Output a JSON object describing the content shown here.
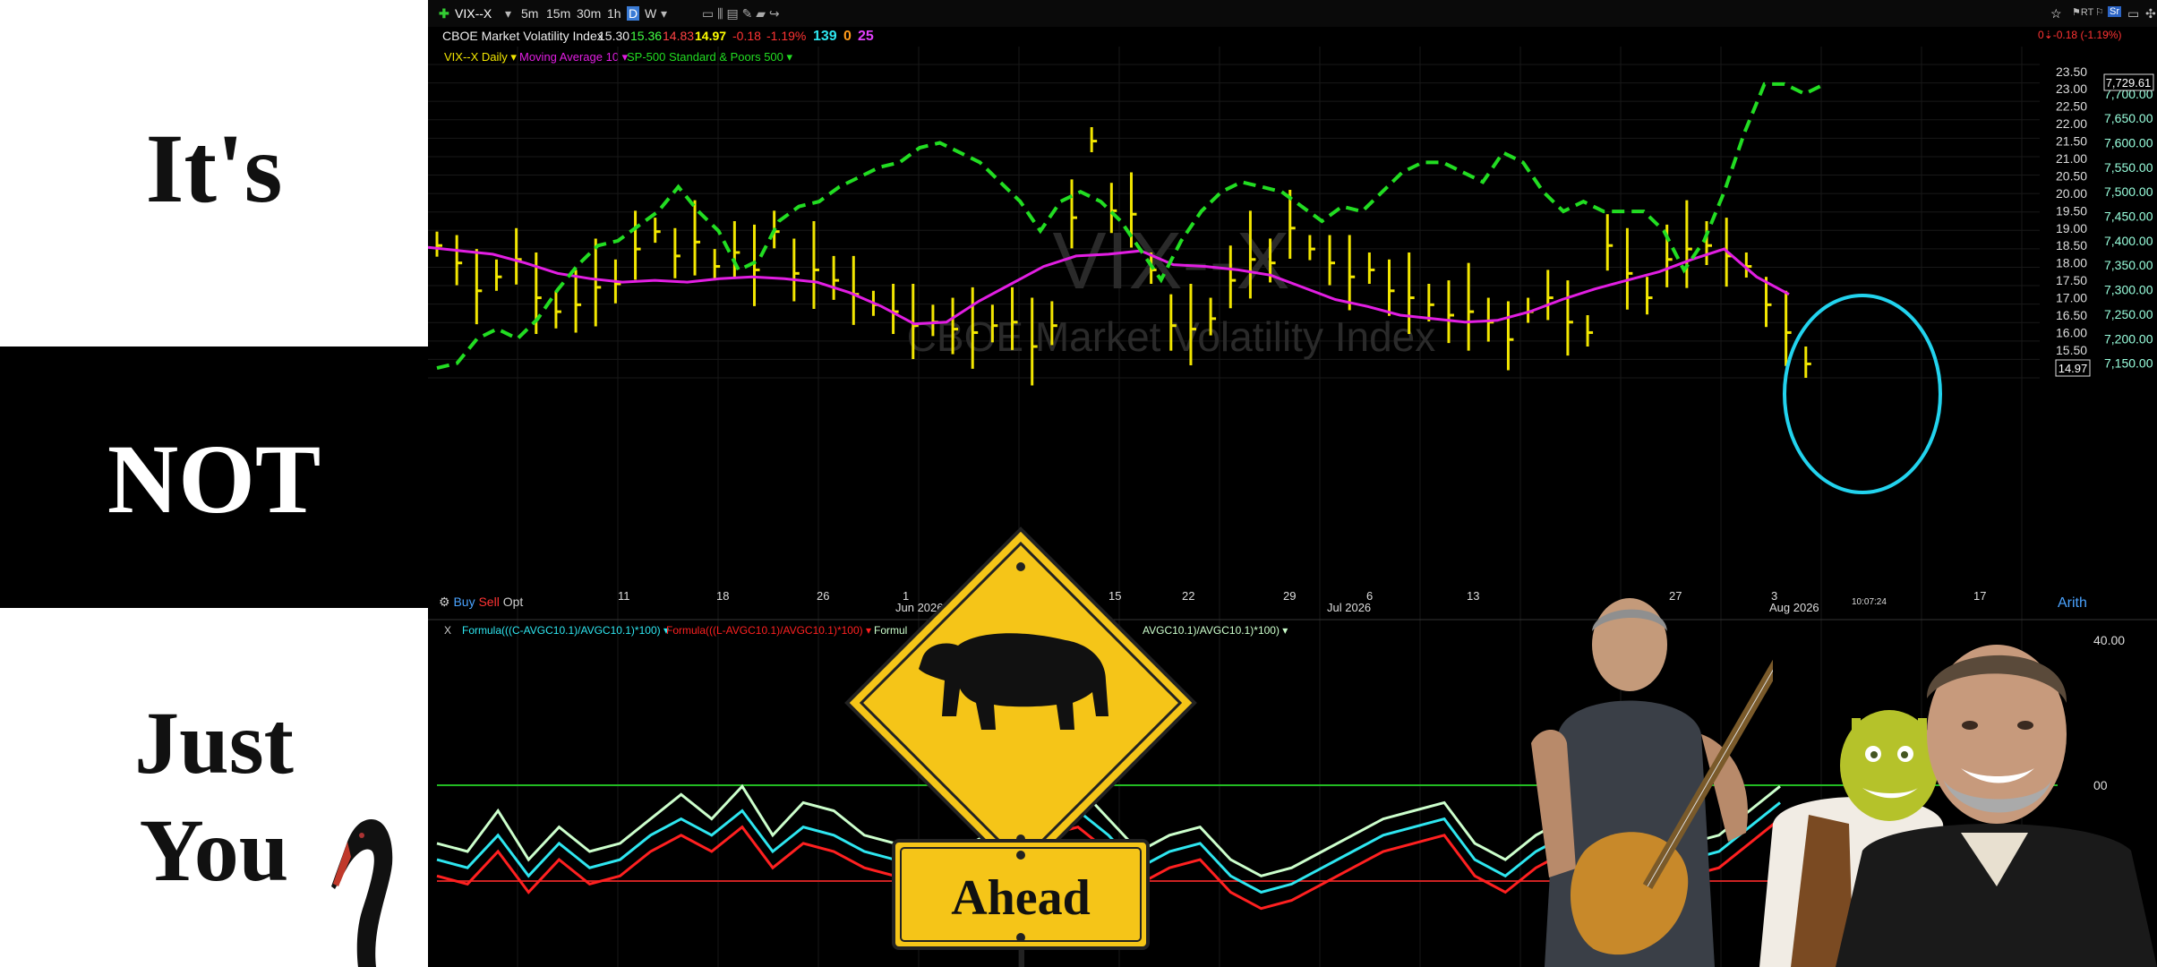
{
  "captions": {
    "line1": "It's",
    "line2": "NOT",
    "line3": "Just",
    "line4": "You"
  },
  "toolbar": {
    "symbol": "VIX--X",
    "intervals": [
      "5m",
      "15m",
      "30m",
      "1h",
      "D",
      "W"
    ],
    "active_interval": "D"
  },
  "quote": {
    "name": "CBOE Market Volatility Index",
    "open": "15.30",
    "high": "15.36",
    "low": "14.83",
    "close": "14.97",
    "change": "-0.18",
    "change_pct": "-1.19%",
    "stat_a": "139",
    "stat_b": "0",
    "stat_c": "25",
    "right_change": "0",
    "right_change_abs": "-0.18",
    "right_change_pct": "(-1.19%)"
  },
  "studies": {
    "price": "VIX--X Daily",
    "ma": "Moving Average 10",
    "overlay": "SP-500 Standard & Poors 500"
  },
  "watermark": {
    "symbol": "VIX--X",
    "name": "CBOE Market Volatility Index"
  },
  "last_price_label": "14.97",
  "last_sp_label": "7,729.61",
  "time_label": "10:07:24",
  "buy_sell": {
    "buy": "Buy",
    "sell": "Sell",
    "opt": "Opt"
  },
  "scale_mode": "Arith",
  "lower_panel": {
    "close_x": "X",
    "formula1": "Formula(((C-AVGC10.1)/AVGC10.1)*100)",
    "formula2": "Formula(((L-AVGC10.1)/AVGC10.1)*100)",
    "formula3": "Formul",
    "formula4": "AVGC10.1)/AVGC10.1)*100)",
    "tick_40": "40.00",
    "tick_20": "00"
  },
  "sign": {
    "text": "Ahead"
  },
  "colors": {
    "price_bars": "#f2e600",
    "moving_average": "#e21ee2",
    "sp500": "#22dd22",
    "circle": "#22d3ee",
    "formula_close": "#2ee6f0",
    "formula_low": "#ff2020",
    "formula_high": "#ccffcc",
    "sign_yellow": "#f5c518"
  },
  "chart_data": [
    {
      "type": "line",
      "title": "CBOE Market Volatility Index",
      "x_ticks": [
        "11",
        "18",
        "26",
        "1",
        "Jun 2026",
        "15",
        "22",
        "29",
        "Jul 2026",
        "6",
        "13",
        "27",
        "3",
        "Aug 2026",
        "17"
      ],
      "y_left_ticks": [
        "23.50",
        "23.00",
        "22.50",
        "22.00",
        "21.50",
        "21.00",
        "20.50",
        "20.00",
        "19.50",
        "19.00",
        "18.50",
        "18.00",
        "17.50",
        "17.00",
        "16.50",
        "16.00",
        "15.50",
        "15.00"
      ],
      "y_right_ticks": [
        "7,700.00",
        "7,650.00",
        "7,600.00",
        "7,550.00",
        "7,500.00",
        "7,450.00",
        "7,400.00",
        "7,350.00",
        "7,300.00",
        "7,250.00",
        "7,200.00",
        "7,150.00"
      ],
      "ylim_left": [
        14.7,
        23.7
      ],
      "ylim_right": [
        7120,
        7760
      ],
      "bar_count": 70,
      "price_closes": [
        18.5,
        18.0,
        17.2,
        17.6,
        18.1,
        17.0,
        16.6,
        16.8,
        17.3,
        17.4,
        18.4,
        18.9,
        18.2,
        18.6,
        17.9,
        18.3,
        17.8,
        18.9,
        17.7,
        17.8,
        17.5,
        17.1,
        16.8,
        16.6,
        16.2,
        16.3,
        16.1,
        16.0,
        16.2,
        16.3,
        15.6,
        16.2,
        19.3,
        21.5,
        19.5,
        19.4,
        17.8,
        16.2,
        16.1,
        16.4,
        17.5,
        18.1,
        18.0,
        19.0,
        18.4,
        18.0,
        17.6,
        17.8,
        17.2,
        17.0,
        16.8,
        16.5,
        16.6,
        16.3,
        15.8,
        16.6,
        17.0,
        16.3,
        16.0,
        18.5,
        17.7,
        17.0,
        18.1,
        18.4,
        18.5,
        18.2,
        17.9,
        16.8,
        16.0,
        15.1
      ],
      "ma_values": [
        18.45,
        18.35,
        18.25,
        18.0,
        17.7,
        17.55,
        17.45,
        17.5,
        17.45,
        17.55,
        17.6,
        17.55,
        17.45,
        17.15,
        16.75,
        16.25,
        16.3,
        16.9,
        17.4,
        17.9,
        18.2,
        18.25,
        18.35,
        17.95,
        17.9,
        17.8,
        17.65,
        17.3,
        16.95,
        16.75,
        16.5,
        16.4,
        16.3,
        16.35,
        16.6,
        16.95,
        17.25,
        17.5,
        17.75,
        18.1,
        18.4,
        17.6,
        17.1
      ],
      "sp500_values": [
        7140,
        7150,
        7200,
        7220,
        7200,
        7240,
        7300,
        7350,
        7390,
        7400,
        7430,
        7460,
        7510,
        7460,
        7420,
        7340,
        7360,
        7440,
        7470,
        7480,
        7510,
        7530,
        7550,
        7560,
        7590,
        7600,
        7580,
        7560,
        7520,
        7480,
        7420,
        7480,
        7500,
        7480,
        7440,
        7380,
        7320,
        7400,
        7460,
        7500,
        7520,
        7510,
        7500,
        7470,
        7440,
        7470,
        7460,
        7500,
        7540,
        7560,
        7560,
        7540,
        7520,
        7580,
        7560,
        7500,
        7460,
        7480,
        7460,
        7460,
        7460,
        7420,
        7340,
        7400,
        7500,
        7620,
        7720,
        7720,
        7700,
        7720
      ]
    },
    {
      "type": "line",
      "title": "",
      "hlines": {
        "upper": "green",
        "lower": "red"
      },
      "series": [
        {
          "values": [
            0.55,
            0.5,
            0.75,
            0.45,
            0.65,
            0.5,
            0.55,
            0.7,
            0.85,
            0.7,
            0.9,
            0.6,
            0.8,
            0.75,
            0.6,
            0.55,
            0.45,
            0.5,
            0.6,
            0.65,
            0.8,
            0.9,
            0.7,
            0.5,
            0.6,
            0.65,
            0.45,
            0.35,
            0.4,
            0.5,
            0.6,
            0.7,
            0.75,
            0.8,
            0.55,
            0.45,
            0.6,
            0.7,
            0.8,
            0.65,
            0.5,
            0.55,
            0.6,
            0.75,
            0.9
          ]
        },
        {
          "values": [
            0.45,
            0.4,
            0.6,
            0.35,
            0.55,
            0.4,
            0.45,
            0.6,
            0.7,
            0.6,
            0.75,
            0.5,
            0.65,
            0.6,
            0.5,
            0.45,
            0.35,
            0.4,
            0.5,
            0.55,
            0.7,
            0.75,
            0.6,
            0.4,
            0.5,
            0.55,
            0.35,
            0.25,
            0.3,
            0.4,
            0.5,
            0.6,
            0.65,
            0.7,
            0.45,
            0.35,
            0.5,
            0.6,
            0.7,
            0.55,
            0.4,
            0.45,
            0.5,
            0.65,
            0.8
          ]
        },
        {
          "values": [
            0.35,
            0.3,
            0.5,
            0.25,
            0.45,
            0.3,
            0.35,
            0.5,
            0.6,
            0.5,
            0.65,
            0.4,
            0.55,
            0.5,
            0.4,
            0.35,
            0.25,
            0.3,
            0.4,
            0.45,
            0.6,
            0.65,
            0.5,
            0.3,
            0.4,
            0.45,
            0.25,
            0.15,
            0.2,
            0.3,
            0.4,
            0.5,
            0.55,
            0.6,
            0.35,
            0.25,
            0.4,
            0.5,
            0.6,
            0.45,
            0.3,
            0.35,
            0.4,
            0.55,
            0.7
          ]
        }
      ]
    }
  ]
}
